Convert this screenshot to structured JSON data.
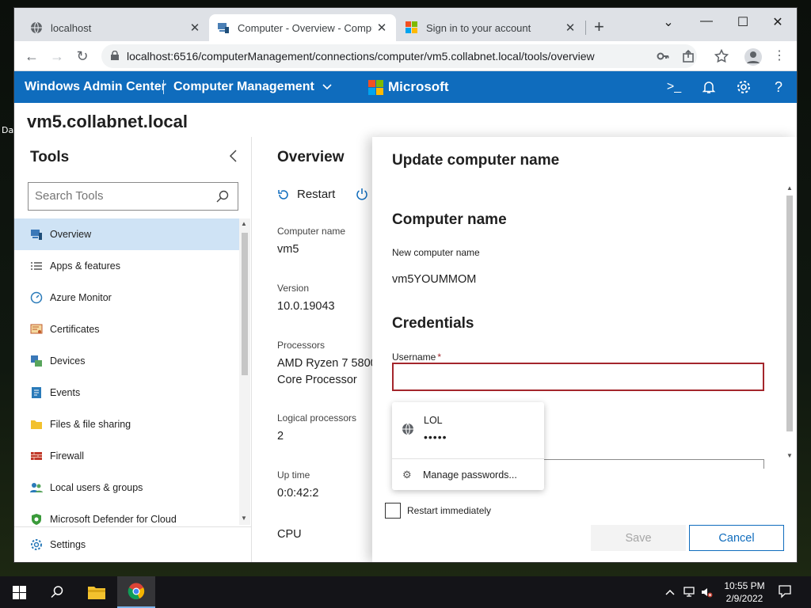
{
  "desktop": {
    "edge_text": "Da"
  },
  "browser": {
    "tabs": [
      {
        "title": "localhost",
        "close": "✕",
        "icon": "globe-icon"
      },
      {
        "title": "Computer - Overview - Computer Management",
        "close": "✕",
        "icon": "wac-icon"
      },
      {
        "title": "Sign in to your account",
        "close": "✕",
        "icon": "microsoft-icon"
      }
    ],
    "new_tab": "+",
    "controls": {
      "dropdown": "⌄",
      "minimize": "—",
      "maximize": "☐",
      "close": "✕"
    },
    "url": "localhost:6516/computerManagement/connections/computer/vm5.collabnet.local/tools/overview",
    "nav": {
      "back": "←",
      "forward": "→",
      "reload": "↻"
    }
  },
  "wac": {
    "app_title": "Windows Admin Center",
    "section": "Computer Management",
    "brand": "Microsoft",
    "icons": {
      "terminal": ">_",
      "bell": "🔔",
      "settings": "⚙",
      "help": "?"
    },
    "colors": {
      "header": "#0f6cbd",
      "error": "#a4262c"
    }
  },
  "page": {
    "server_name": "vm5.collabnet.local"
  },
  "tools": {
    "heading": "Tools",
    "search_placeholder": "Search Tools",
    "items": [
      {
        "label": "Overview",
        "icon": "overview-icon",
        "active": true
      },
      {
        "label": "Apps & features",
        "icon": "apps-list-icon"
      },
      {
        "label": "Azure Monitor",
        "icon": "azure-monitor-icon"
      },
      {
        "label": "Certificates",
        "icon": "certificate-icon"
      },
      {
        "label": "Devices",
        "icon": "devices-icon"
      },
      {
        "label": "Events",
        "icon": "events-icon"
      },
      {
        "label": "Files & file sharing",
        "icon": "folder-icon"
      },
      {
        "label": "Firewall",
        "icon": "firewall-icon"
      },
      {
        "label": "Local users & groups",
        "icon": "users-icon"
      },
      {
        "label": "Microsoft Defender for Cloud",
        "icon": "shield-icon"
      }
    ],
    "settings_label": "Settings"
  },
  "overview": {
    "title": "Overview",
    "restart_label": "Restart",
    "properties": [
      {
        "label": "Computer name",
        "value": "vm5"
      },
      {
        "label": "Version",
        "value": "10.0.19043"
      },
      {
        "label": "Processors",
        "value": "AMD Ryzen 7 5800",
        "value2": "Core Processor"
      },
      {
        "label": "Logical processors",
        "value": "2"
      },
      {
        "label": "Up time",
        "value": "0:0:42:2"
      },
      {
        "label": "CPU",
        "value": ""
      }
    ]
  },
  "dialog": {
    "title": "Update computer name",
    "computer_name_heading": "Computer name",
    "new_name_label": "New computer name",
    "new_name_value": "vm5YOUMMOM",
    "credentials_heading": "Credentials",
    "username_label": "Username",
    "required_marker": "*",
    "username_value": "",
    "autofill": {
      "username": "LOL",
      "password_mask": "•••••",
      "manage_label": "Manage passwords..."
    },
    "restart_label": "Restart immediately",
    "save_label": "Save",
    "cancel_label": "Cancel"
  },
  "taskbar": {
    "time": "10:55 PM",
    "date": "2/9/2022"
  }
}
